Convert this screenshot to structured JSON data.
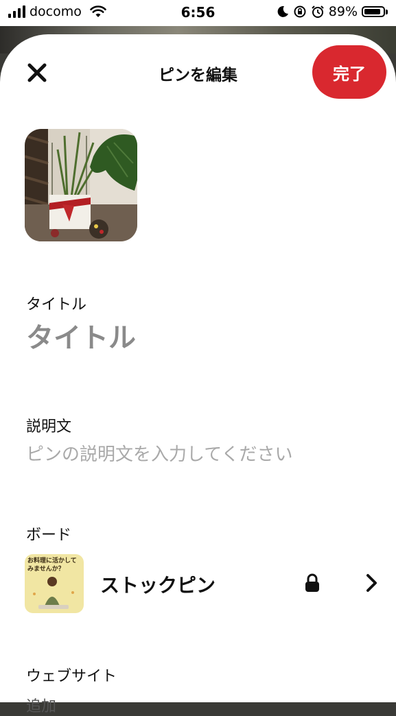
{
  "status_bar": {
    "carrier": "docomo",
    "time": "6:56",
    "battery_percent": "89%",
    "battery_level": 0.89,
    "icons": [
      "signal-icon",
      "wifi-icon",
      "moon-icon",
      "orientation-lock-icon",
      "alarm-icon",
      "battery-icon"
    ]
  },
  "header": {
    "title": "ピンを編集",
    "close_icon": "close-icon",
    "done_label": "完了"
  },
  "pin": {
    "image": "plant-photo"
  },
  "fields": {
    "title_label": "タイトル",
    "title_placeholder": "タイトル",
    "description_label": "説明文",
    "description_placeholder": "ピンの説明文を入力してください",
    "board_label": "ボード",
    "board_name": "ストックピン",
    "board_thumb_text": "お料理に活かして みませんか？",
    "website_label": "ウェブサイト",
    "website_value": "追加"
  },
  "colors": {
    "accent": "#d9282f",
    "placeholder": "#a9a9a9"
  }
}
